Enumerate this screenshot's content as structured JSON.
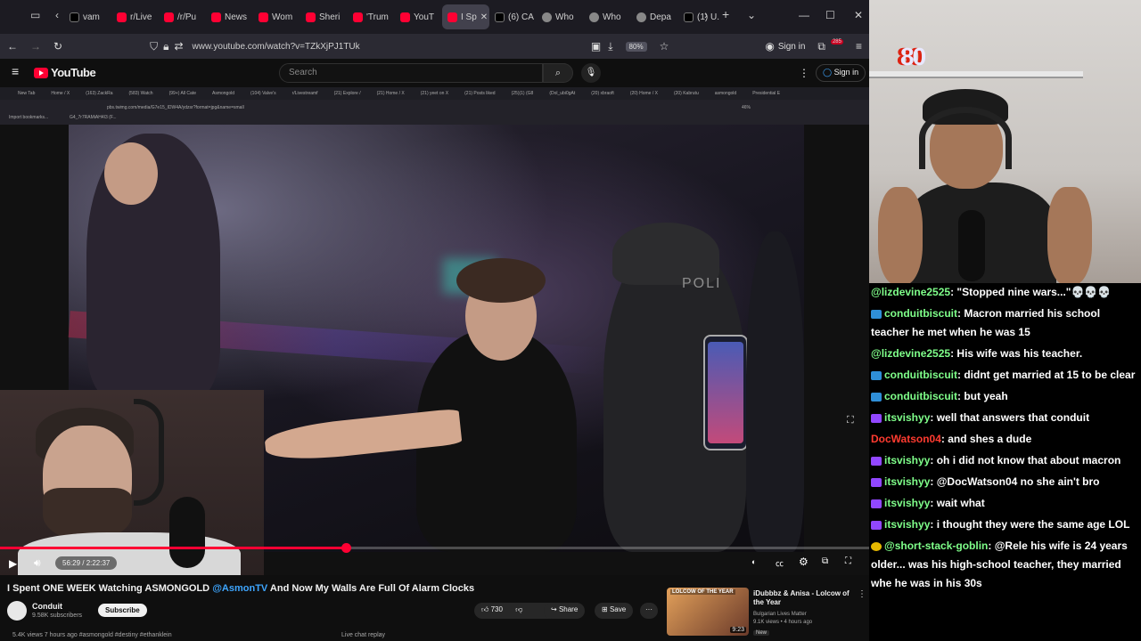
{
  "browser": {
    "tabs": [
      {
        "label": "vam",
        "icon": "x-icon"
      },
      {
        "label": "r/Live",
        "icon": "reddit-icon"
      },
      {
        "label": "/r/Pu",
        "icon": "reddit-icon"
      },
      {
        "label": "News",
        "icon": "youtube-icon"
      },
      {
        "label": "Wom",
        "icon": "youtube-icon"
      },
      {
        "label": "Sheri",
        "icon": "youtube-icon"
      },
      {
        "label": "'Trum",
        "icon": "youtube-icon"
      },
      {
        "label": "YouT",
        "icon": "youtube-icon"
      },
      {
        "label": "I Sp",
        "icon": "youtube-icon"
      },
      {
        "label": "(6) CA",
        "icon": "x-icon"
      },
      {
        "label": "Who",
        "icon": "generic-icon"
      },
      {
        "label": "Who",
        "icon": "generic-icon"
      },
      {
        "label": "Depa",
        "icon": "generic-icon"
      },
      {
        "label": "(1) U.",
        "icon": "x-icon"
      }
    ],
    "url": "www.youtube.com/watch?v=TZkXjPJ1TUk",
    "zoom": "80%",
    "signin_label": "Sign in",
    "extension_badge": "285"
  },
  "youtube": {
    "logo_text": "YouTube",
    "search_placeholder": "Search",
    "signin_label": "Sign in"
  },
  "inner_browser": {
    "tabs": [
      "New Tab",
      "Home / X",
      "(163) ZackRa",
      "(583) Watch",
      "(99+) All Cate",
      "Asmongold",
      "(104) Valve's",
      "r/Livestreamf",
      "(21) Explore /",
      "(21) Home / X",
      "(21) yeet on X",
      "(21) Posts liked",
      "(25)(1) (G8",
      "(Dol_ubi0gAt",
      "(20) xbraoft",
      "(20) Home / X",
      "(20) Kabrutu",
      "asmongold",
      "Presidential E"
    ],
    "url": "pbs.twimg.com/media/G7e15_IDW4A/ydzsr?format=jpg&name=small",
    "bookmarks": "Import bookmarks...",
    "zoom": "46%",
    "sidenote": "G4_7r7RAMiAH4I3 (F..."
  },
  "video": {
    "overlay_text": "POLI",
    "current_time": "56:29",
    "duration": "2:22:37",
    "time_display": "56:29 / 2:22:37",
    "progress_fraction": 0.398
  },
  "below_video": {
    "title_prefix": "I Spent ONE WEEK Watching ASMONGOLD ",
    "title_mention": "@AsmonTV",
    "title_suffix": " And Now My Walls Are Full Of Alarm Clocks",
    "channel": "Conduit",
    "subscribers": "9.58K subscribers",
    "subscribe_label": "Subscribe",
    "likes": "730",
    "share_label": "Share",
    "save_label": "Save",
    "views": "5.4K views  7 hours ago  #asmongold #destiny #ethanklein",
    "live_chat": "Live chat replay"
  },
  "recommendation": {
    "thumb_label": "LOLCOW OF THE YEAR",
    "duration": "9:23",
    "title": "iDubbbz & Anisa - Lolcow of the Year",
    "channel": "Bulgarian Lives Matter",
    "meta": "9.1K views • 4 hours ago",
    "badge": "New"
  },
  "streamer": {
    "counter": "80"
  },
  "chat": [
    {
      "user": "@lizdevine2525",
      "color": "#7fff8a",
      "badge": "",
      "text": ": \"Stopped nine wars...\"💀💀💀"
    },
    {
      "user": "conduitbiscuit",
      "color": "#7fff8a",
      "badge": "blue",
      "text": ": Macron married his school teacher he met when he was 15"
    },
    {
      "user": "@lizdevine2525",
      "color": "#7fff8a",
      "badge": "",
      "text": ": His wife was his teacher."
    },
    {
      "user": "conduitbiscuit",
      "color": "#7fff8a",
      "badge": "blue",
      "text": ": didnt get married at 15 to be clear"
    },
    {
      "user": "conduitbiscuit",
      "color": "#7fff8a",
      "badge": "blue",
      "text": ": but yeah"
    },
    {
      "user": "itsvishyy",
      "color": "#7fff8a",
      "badge": "purple",
      "text": ": well that answers that conduit"
    },
    {
      "user": "DocWatson04",
      "color": "#ff3b30",
      "badge": "",
      "text": ": and shes a dude"
    },
    {
      "user": "itsvishyy",
      "color": "#7fff8a",
      "badge": "purple",
      "text": ": oh i did not know that about macron"
    },
    {
      "user": "itsvishyy",
      "color": "#7fff8a",
      "badge": "purple",
      "text": ": @DocWatson04 no she ain't bro"
    },
    {
      "user": "itsvishyy",
      "color": "#7fff8a",
      "badge": "purple",
      "text": ": wait what"
    },
    {
      "user": "itsvishyy",
      "color": "#7fff8a",
      "badge": "purple",
      "text": ": i thought they were the same age LOL"
    },
    {
      "user": "@short-stack-goblin",
      "color": "#7fff8a",
      "badge": "gold",
      "text": ": @Rele his wife is 24 years older... was his high-school teacher, they married whe he was in his 30s"
    }
  ]
}
